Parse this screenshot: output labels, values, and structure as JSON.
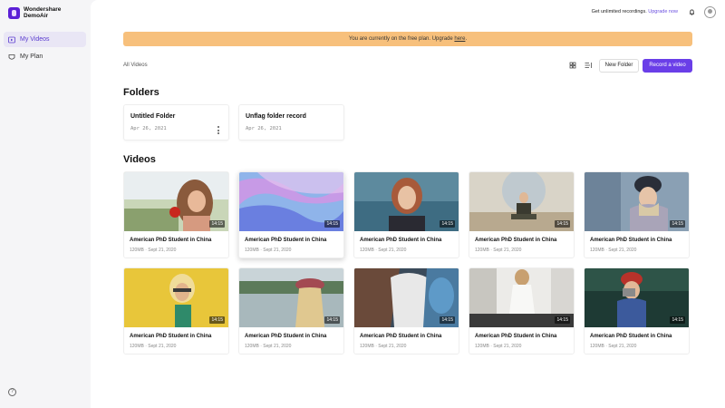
{
  "app": {
    "brand_line1": "Wondershare",
    "brand_line2": "DemoAir"
  },
  "sidebar": {
    "items": [
      {
        "label": "My Videos",
        "active": true
      },
      {
        "label": "My Plan",
        "active": false
      }
    ]
  },
  "topbar": {
    "promo_text": "Get unlimited recordings.",
    "upgrade_link": "Upgrade now"
  },
  "banner": {
    "text": "You are currently on the free plan. Upgrade",
    "link": "here",
    "suffix": ".",
    "color": "#f7c07c"
  },
  "toolbar": {
    "breadcrumb": "All Videos",
    "new_folder": "New Folder",
    "record": "Record a video",
    "accent": "#6a3ee8"
  },
  "folders": {
    "title": "Folders",
    "items": [
      {
        "name": "Untitled Folder",
        "date": "Apr 26, 2021"
      },
      {
        "name": "Unflag folder record",
        "date": "Apr 26, 2021"
      }
    ]
  },
  "videos": {
    "title": "Videos",
    "items": [
      {
        "title": "American PhD Student in China",
        "meta": "120MB · Sept 21, 2020",
        "duration": "14:15"
      },
      {
        "title": "American PhD Student in China",
        "meta": "120MB · Sept 21, 2020",
        "duration": "14:15"
      },
      {
        "title": "American PhD Student in China",
        "meta": "120MB · Sept 21, 2020",
        "duration": "14:15"
      },
      {
        "title": "American PhD Student in China",
        "meta": "120MB · Sept 21, 2020",
        "duration": "14:15"
      },
      {
        "title": "American PhD Student in China",
        "meta": "120MB · Sept 21, 2020",
        "duration": "14:15"
      },
      {
        "title": "American PhD Student in China",
        "meta": "120MB · Sept 21, 2020",
        "duration": "14:15"
      },
      {
        "title": "American PhD Student in China",
        "meta": "120MB · Sept 21, 2020",
        "duration": "14:15"
      },
      {
        "title": "American PhD Student in China",
        "meta": "120MB · Sept 21, 2020",
        "duration": "14:15"
      },
      {
        "title": "American PhD Student in China",
        "meta": "120MB · Sept 21, 2020",
        "duration": "14:15"
      },
      {
        "title": "American PhD Student in China",
        "meta": "120MB · Sept 21, 2020",
        "duration": "14:15"
      }
    ]
  }
}
